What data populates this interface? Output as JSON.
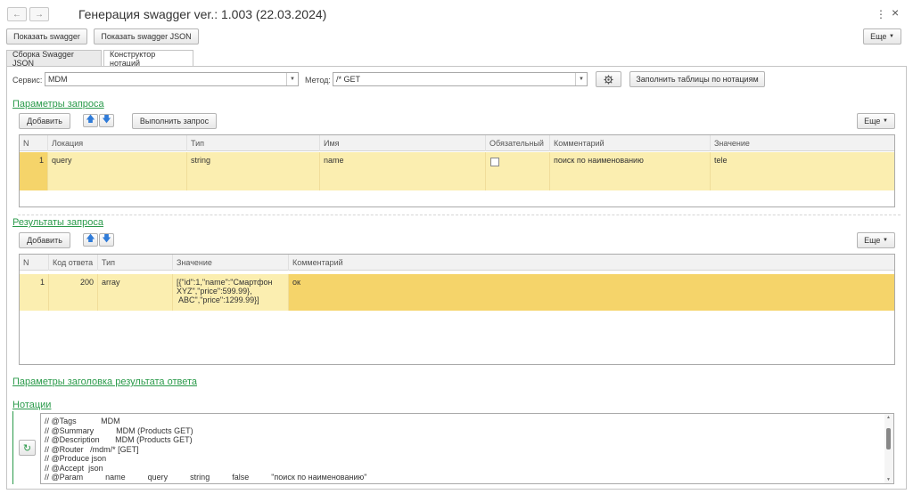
{
  "window": {
    "title": "Генерация swagger ver.: 1.003 (22.03.2024)",
    "back_icon": "←",
    "forward_icon": "→",
    "menu_icon": "⋮",
    "close_icon": "×"
  },
  "toolbar": {
    "show_swagger": "Показать swagger",
    "show_swagger_json": "Показать swagger JSON",
    "more": "Еще"
  },
  "tabs": [
    {
      "label": "Сборка Swagger JSON",
      "active": false
    },
    {
      "label": "Конструктор нотаций",
      "active": true
    }
  ],
  "form": {
    "service_label": "Сервис:",
    "service_value": "MDM",
    "method_label": "Метод:",
    "method_value": "/* GET",
    "fill_tables": "Заполнить таблицы по нотациям"
  },
  "request_params": {
    "title": "Параметры запроса",
    "add": "Добавить",
    "execute": "Выполнить запрос",
    "more": "Еще",
    "columns": [
      "N",
      "Локация",
      "Тип",
      "Имя",
      "Обязательный",
      "Комментарий",
      "Значение"
    ],
    "rows": [
      {
        "n": "1",
        "location": "query",
        "type": "string",
        "name": "name",
        "required": false,
        "comment": "поиск по наименованию",
        "value": "tele"
      }
    ]
  },
  "request_results": {
    "title": "Результаты запроса",
    "add": "Добавить",
    "more": "Еще",
    "columns": [
      "N",
      "Код ответа",
      "Тип",
      "Значение",
      "Комментарий"
    ],
    "rows": [
      {
        "n": "1",
        "code": "200",
        "type": "array",
        "value_lines": [
          "[{\"id\":1,\"name\":\"Смартфон",
          "XYZ\",\"price\":599.99},",
          " ABC\",\"price\":1299.99}]"
        ],
        "comment": "ок"
      }
    ]
  },
  "header_params": {
    "title": "Параметры заголовка результата ответа"
  },
  "notations": {
    "title": "Нотации",
    "lines": [
      "// @Tags           MDM",
      "// @Summary          MDM (Products GET)",
      "// @Description       MDM (Products GET)",
      "// @Router   /mdm/* [GET]",
      "// @Produce json",
      "// @Accept  json",
      "// @Param          name          query          string          false          \"поиск по наименованию\""
    ]
  }
}
